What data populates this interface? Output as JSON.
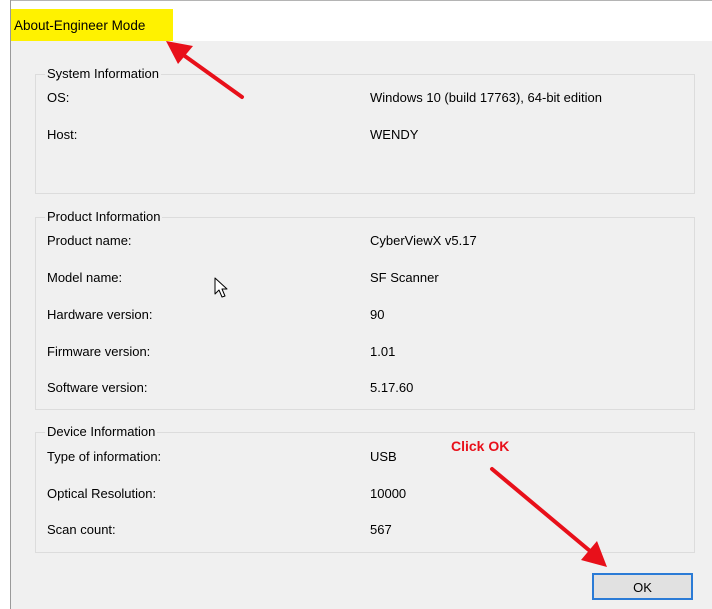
{
  "window": {
    "title": "About-Engineer Mode"
  },
  "system_information": {
    "heading": "System Information",
    "rows": [
      {
        "label": "OS:",
        "value": "Windows 10 (build 17763), 64-bit edition"
      },
      {
        "label": "Host:",
        "value": "WENDY"
      }
    ]
  },
  "product_information": {
    "heading": "Product Information",
    "rows": [
      {
        "label": "Product name:",
        "value": "CyberViewX v5.17"
      },
      {
        "label": "Model name:",
        "value": "SF Scanner"
      },
      {
        "label": "Hardware version:",
        "value": "90"
      },
      {
        "label": "Firmware version:",
        "value": "1.01"
      },
      {
        "label": "Software version:",
        "value": "5.17.60"
      }
    ]
  },
  "device_information": {
    "heading": "Device Information",
    "rows": [
      {
        "label": "Type of information:",
        "value": "USB"
      },
      {
        "label": "Optical Resolution:",
        "value": "10000"
      },
      {
        "label": "Scan count:",
        "value": "567"
      }
    ]
  },
  "buttons": {
    "ok_label": "OK"
  },
  "annotations": {
    "click_ok_text": "Click OK",
    "arrow_color": "#e8101a",
    "highlight_color": "#fff200"
  }
}
